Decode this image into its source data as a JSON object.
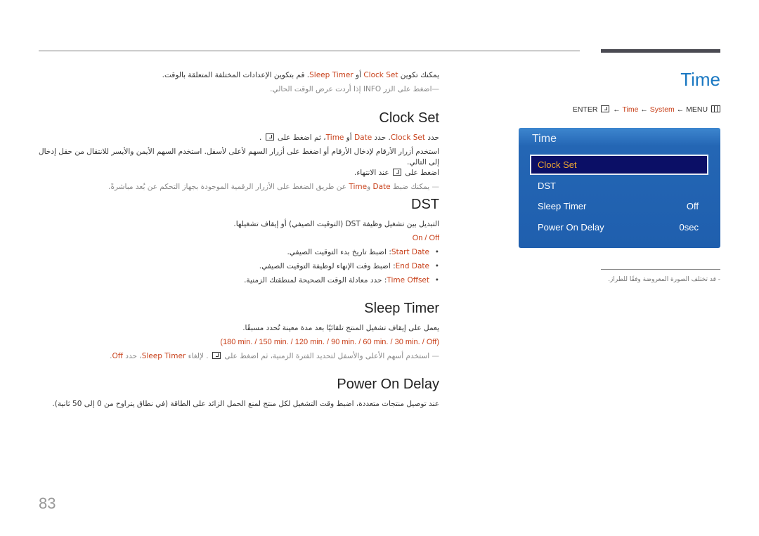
{
  "header": {
    "section_title": "Time",
    "nav": {
      "enter": "ENTER",
      "arrow": "←",
      "time": "Time",
      "system": "System",
      "menu": "MENU"
    }
  },
  "osd": {
    "title": "Time",
    "items": [
      {
        "label": "Clock Set",
        "value": "",
        "selected": true
      },
      {
        "label": "DST",
        "value": ""
      },
      {
        "label": "Sleep Timer",
        "value": "Off"
      },
      {
        "label": "Power On Delay",
        "value": "0sec"
      }
    ]
  },
  "side_note": "-  قد تختلف الصورة المعروضة وفقًا للطراز.",
  "intro": {
    "p1_a": "يمكنك تكوين ",
    "p1_clock": "Clock Set",
    "p1_b": " أو ",
    "p1_sleep": "Sleep Timer",
    "p1_c": ". قم بتكوين الإعدادات المختلفة المتعلقة بالوقت.",
    "note": "اضغط على الزر INFO إذا أردت عرض الوقت الحالي."
  },
  "clock_set": {
    "heading": "Clock Set",
    "p1_a": "حدد ",
    "p1_clock": "Clock Set",
    "p1_b": ". حدد ",
    "p1_date": "Date",
    "p1_c": " أو ",
    "p1_time": "Time",
    "p1_d": "، ثم اضغط على ",
    "p1_e": " .",
    "p2": "استخدم أزرار الأرقام لإدخال الأرقام أو اضغط على أزرار السهم لأعلى لأسفل. استخدم السهم الأيمن والأيسر للانتقال من حقل إدخال إلى التالي.",
    "p3_a": "اضغط على ",
    "p3_b": " عند الانتهاء.",
    "note_a": "يمكنك ضبط ",
    "note_date": "Date",
    "note_b": " و",
    "note_time": "Time",
    "note_c": " عن طريق الضغط على الأزرار الرقمية الموجودة بجهاز التحكم عن بُعد مباشرةً."
  },
  "dst": {
    "heading": "DST",
    "p1": "التبديل بين تشغيل وظيفة DST (التوقيت الصيفي) أو إيقاف تشغيلها.",
    "options": "On / Off",
    "bullets": [
      {
        "term": "Start Date",
        "text": ": اضبط تاريخ بدء التوقيت الصيفي."
      },
      {
        "term": "End Date",
        "text": ": اضبط وقت الإنهاء لوظيفة التوقيت الصيفي."
      },
      {
        "term": "Time Offset",
        "text": ": حدد معادلة الوقت الصحيحة لمنطقتك الزمنية."
      }
    ]
  },
  "sleep_timer": {
    "heading": "Sleep Timer",
    "p1": "يعمل على إيقاف تشغيل المنتج تلقائيًا بعد مدة معينة تُحدد مسبقًا.",
    "options": "(180 min. / 150 min. / 120 min. / 90 min. / 60 min. / 30 min. / Off)",
    "note_a": "استخدم أسهم الأعلى والأسفل لتحديد الفترة الزمنية، ثم اضغط على ",
    "note_b": " . لإلغاء ",
    "note_sleep": "Sleep Timer",
    "note_c": "، حدد ",
    "note_off": "Off",
    "note_d": "."
  },
  "power_on_delay": {
    "heading": "Power On Delay",
    "p1": "عند توصيل منتجات متعددة، اضبط وقت التشغيل لكل منتج لمنع الحمل الزائد على الطاقة (في نطاق يتراوح من 0 إلى 50 ثانية)."
  },
  "page_number": "83",
  "colors": {
    "accent_blue": "#1a78c2",
    "highlight_orange": "#c8401a",
    "osd_bg": "#1f5fae",
    "osd_selected_bg": "#0b0f66",
    "osd_selected_text": "#f0a830"
  }
}
